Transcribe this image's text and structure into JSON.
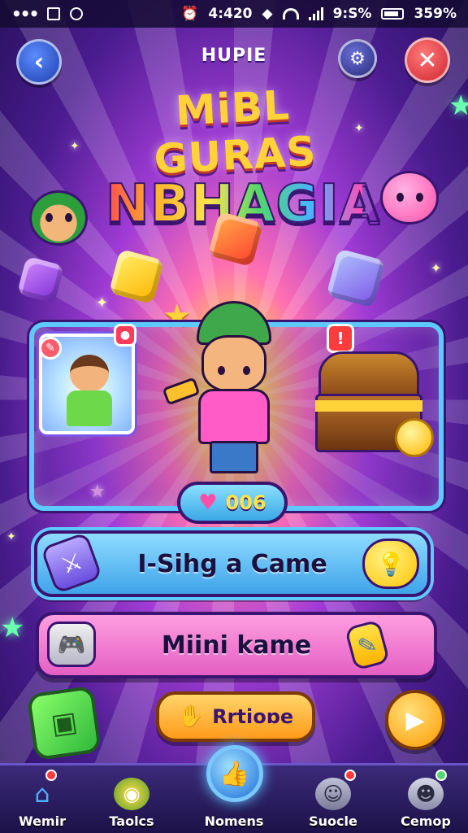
{
  "status_bar": {
    "dots": "•••",
    "time": "4:420",
    "signal_text": "9:S%",
    "battery": "359%"
  },
  "header": {
    "title": "HUPIE",
    "back_icon": "arrow-left-icon",
    "settings_icon": "gear-icon",
    "close_icon": "close-icon"
  },
  "logo": {
    "line1": "MiBL GURAS",
    "line2": "NBHAGIA"
  },
  "score": {
    "value": "006",
    "icon": "heart-icon"
  },
  "menu": {
    "play_label": "I-Sihg a Came",
    "mini_label": "Miini kame",
    "reward_label": "Rrtioɒe"
  },
  "card_badges": {
    "right": "!"
  },
  "nav": {
    "items": [
      {
        "label": "Wemir",
        "icon": "home-icon"
      },
      {
        "label": "Taolcs",
        "icon": "globe-icon"
      },
      {
        "label": "Nomens",
        "icon": "thumbs-up-icon"
      },
      {
        "label": "Suocle",
        "icon": "friends-icon"
      },
      {
        "label": "Cemop",
        "icon": "profile-icon"
      }
    ]
  },
  "colors": {
    "accent_blue": "#5ec9ff",
    "accent_pink": "#e45fc3",
    "accent_orange": "#ff9a1a",
    "background_deep": "#25105a"
  }
}
